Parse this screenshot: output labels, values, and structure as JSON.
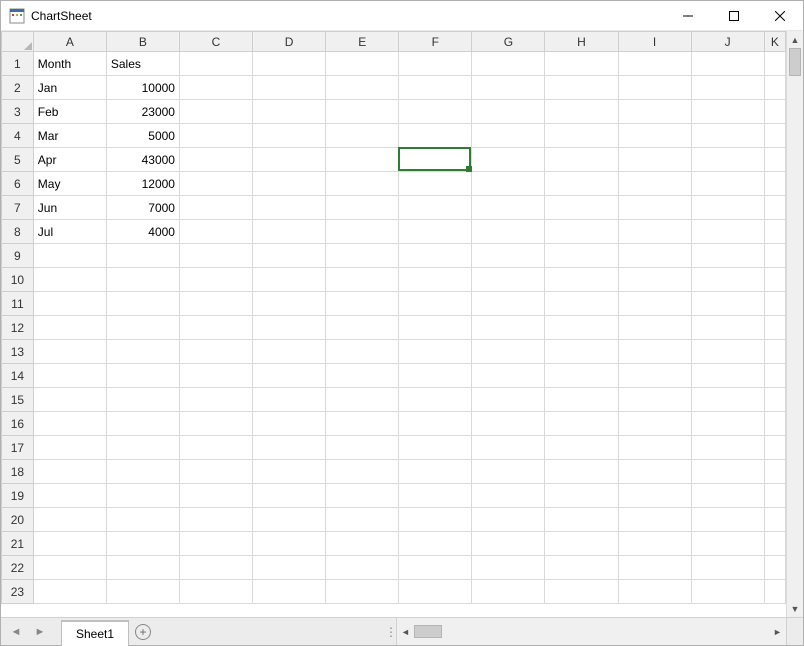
{
  "window": {
    "title": "ChartSheet"
  },
  "columns": [
    "A",
    "B",
    "C",
    "D",
    "E",
    "F",
    "G",
    "H",
    "I",
    "J",
    "K"
  ],
  "row_count": 23,
  "active_cell": {
    "col": "F",
    "row": 5
  },
  "cells": {
    "A1": "Month",
    "B1": "Sales",
    "A2": "Jan",
    "B2": 10000,
    "A3": "Feb",
    "B3": 23000,
    "A4": "Mar",
    "B4": 5000,
    "A5": "Apr",
    "B5": 43000,
    "A6": "May",
    "B6": 12000,
    "A7": "Jun",
    "B7": 7000,
    "A8": "Jul",
    "B8": 4000
  },
  "tabs": {
    "prev_outer_enabled": false,
    "prev_enabled": false,
    "sheets": [
      "Sheet1"
    ],
    "active_sheet": "Sheet1"
  },
  "chart_data": {
    "type": "table",
    "categories": [
      "Jan",
      "Feb",
      "Mar",
      "Apr",
      "May",
      "Jun",
      "Jul"
    ],
    "series": [
      {
        "name": "Sales",
        "values": [
          10000,
          23000,
          5000,
          43000,
          12000,
          7000,
          4000
        ]
      }
    ],
    "title": "",
    "xlabel": "Month",
    "ylabel": "Sales"
  },
  "colors": {
    "selection_border": "#2e7d32",
    "header_bg": "#f0f0f0",
    "grid_line": "#d9d9d9"
  }
}
